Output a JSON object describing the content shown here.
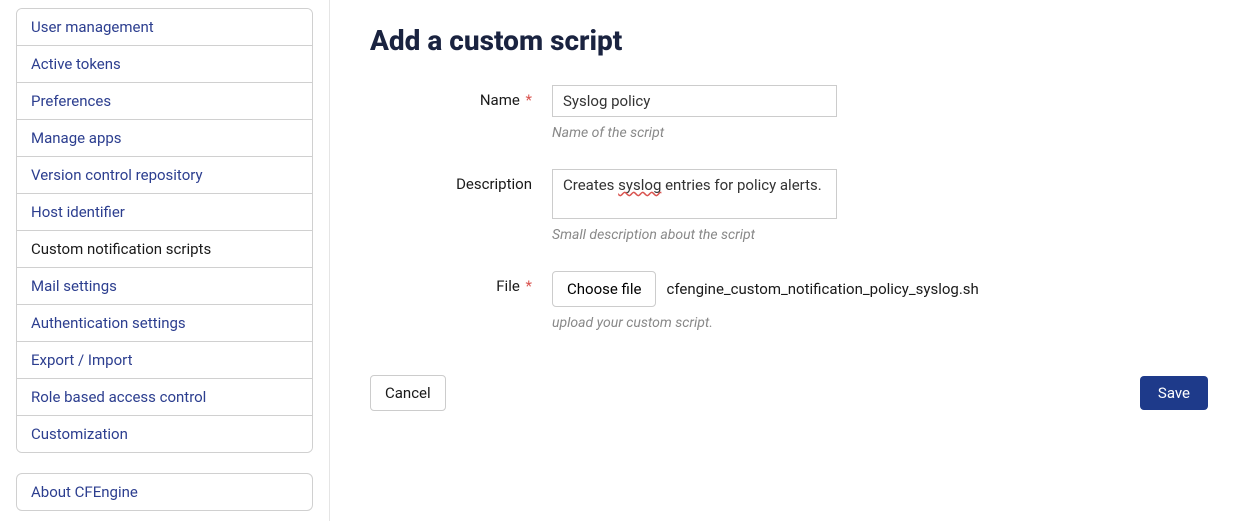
{
  "sidebar": {
    "items": [
      {
        "label": "User management",
        "active": false
      },
      {
        "label": "Active tokens",
        "active": false
      },
      {
        "label": "Preferences",
        "active": false
      },
      {
        "label": "Manage apps",
        "active": false
      },
      {
        "label": "Version control repository",
        "active": false
      },
      {
        "label": "Host identifier",
        "active": false
      },
      {
        "label": "Custom notification scripts",
        "active": true
      },
      {
        "label": "Mail settings",
        "active": false
      },
      {
        "label": "Authentication settings",
        "active": false
      },
      {
        "label": "Export / Import",
        "active": false
      },
      {
        "label": "Role based access control",
        "active": false
      },
      {
        "label": "Customization",
        "active": false
      }
    ],
    "about_label": "About CFEngine"
  },
  "main": {
    "title": "Add a custom script",
    "form": {
      "name": {
        "label": "Name",
        "required_mark": "*",
        "value": "Syslog policy",
        "help": "Name of the script"
      },
      "description": {
        "label": "Description",
        "value_prefix": "Creates ",
        "value_spell": "syslog",
        "value_suffix": " entries for policy alerts.",
        "help": "Small description about the script"
      },
      "file": {
        "label": "File",
        "required_mark": "*",
        "button_label": "Choose file",
        "filename": "cfengine_custom_notification_policy_syslog.sh",
        "help": "upload your custom script."
      }
    },
    "actions": {
      "cancel": "Cancel",
      "save": "Save"
    }
  }
}
